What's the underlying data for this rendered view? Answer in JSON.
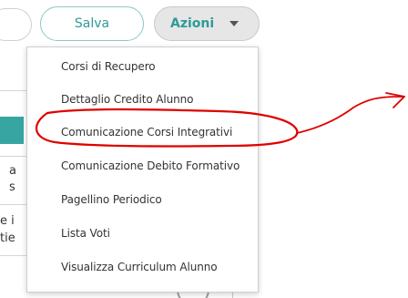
{
  "toolbar": {
    "save_label": "Salva",
    "actions_label": "Azioni"
  },
  "left_fragments": [
    "a",
    "s",
    "e i",
    "tie"
  ],
  "menu": {
    "items": [
      "Corsi di Recupero",
      "Dettaglio Credito Alunno",
      "Comunicazione Corsi Integrativi",
      "Comunicazione Debito Formativo",
      "Pagellino Periodico",
      "Lista Voti",
      "Visualizza Curriculum Alunno"
    ]
  },
  "colors": {
    "accent": "#2f9a97",
    "annotation": "#e00000"
  }
}
